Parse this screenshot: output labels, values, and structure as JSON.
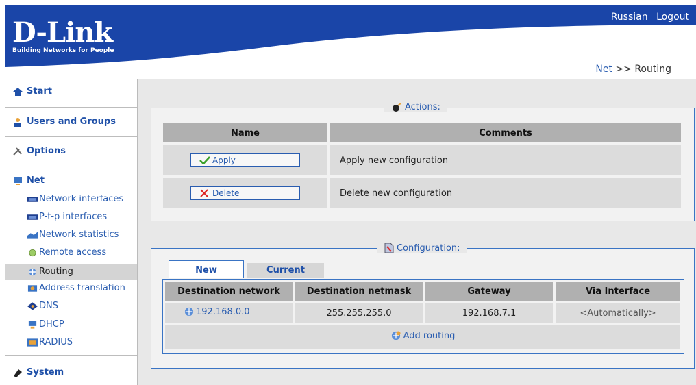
{
  "brand": {
    "name": "D-Link",
    "tagline": "Building Networks for People"
  },
  "topnav": {
    "russian": "Russian",
    "logout": "Logout"
  },
  "breadcrumb": {
    "section": "Net",
    "separator": ">>",
    "page": "Routing"
  },
  "sidebar": {
    "start": "Start",
    "users": "Users and Groups",
    "options": "Options",
    "net": "Net",
    "net_items": [
      {
        "label": "Network interfaces",
        "icon": "network-card-icon"
      },
      {
        "label": "P-t-p interfaces",
        "icon": "network-card-icon"
      },
      {
        "label": "Network statistics",
        "icon": "chart-icon"
      },
      {
        "label": "Remote access",
        "icon": "remote-access-icon"
      },
      {
        "label": "Routing",
        "icon": "routing-icon",
        "active": true
      },
      {
        "label": "Address translation",
        "icon": "translation-icon"
      },
      {
        "label": "DNS",
        "icon": "dns-icon"
      },
      {
        "label": "DHCP",
        "icon": "dhcp-icon"
      },
      {
        "label": "RADIUS",
        "icon": "radius-icon"
      }
    ],
    "system": "System"
  },
  "actions": {
    "legend": "Actions:",
    "col_name": "Name",
    "col_comments": "Comments",
    "apply_label": "Apply",
    "apply_comment": "Apply new configuration",
    "delete_label": "Delete",
    "delete_comment": "Delete new configuration"
  },
  "configuration": {
    "legend": "Configuration:",
    "tab_new": "New",
    "tab_current": "Current",
    "columns": [
      "Destination network",
      "Destination netmask",
      "Gateway",
      "Via Interface"
    ],
    "rows": [
      {
        "network": "192.168.0.0",
        "netmask": "255.255.255.0",
        "gateway": "192.168.7.1",
        "iface": "<Automatically>"
      }
    ],
    "add_label": "Add routing"
  },
  "colors": {
    "brand_blue": "#1a45a8",
    "link_blue": "#2a5db0",
    "green_check": "#3aa12a",
    "red_x": "#d22"
  }
}
